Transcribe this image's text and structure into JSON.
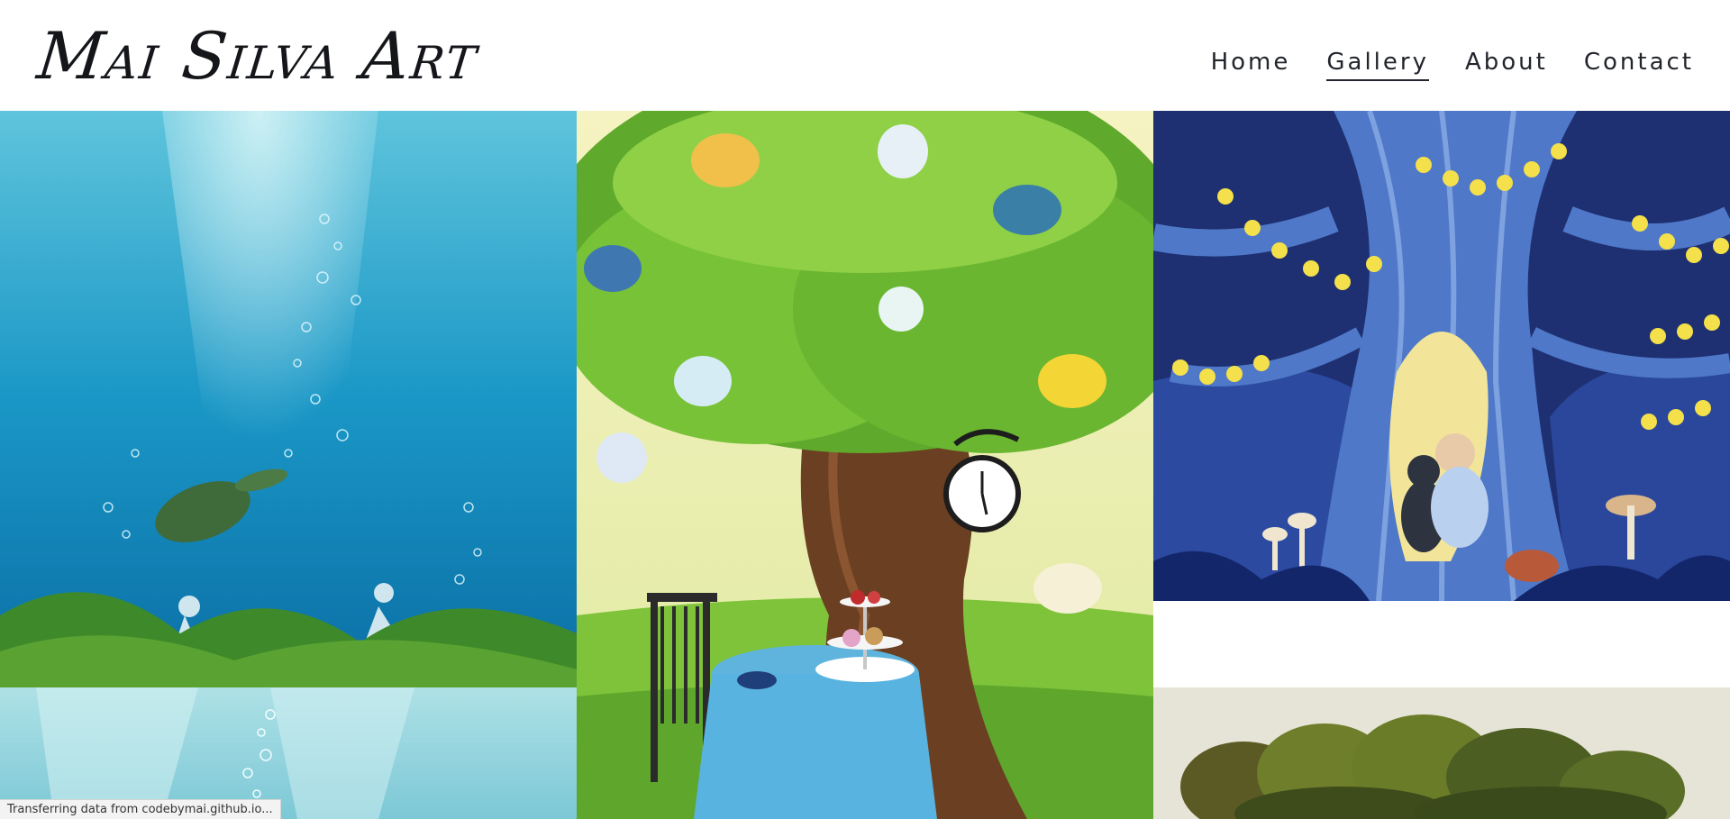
{
  "site": {
    "logo_text": "Mai Silva Art"
  },
  "nav": {
    "items": [
      {
        "label": "Home"
      },
      {
        "label": "Gallery"
      },
      {
        "label": "About"
      },
      {
        "label": "Contact"
      }
    ]
  },
  "gallery": {
    "artworks": [
      {
        "name": "ocean-turtles-girls-painting"
      },
      {
        "name": "teapot-tree-painting"
      },
      {
        "name": "night-tree-reading-girl-painting"
      },
      {
        "name": "ocean-light-rays-painting"
      },
      {
        "name": "green-treetops-painting"
      }
    ]
  },
  "status_bar": {
    "text": "Transferring data from codebymai.github.io..."
  },
  "colors": {
    "nav_text": "#22252b",
    "logo_text": "#14161a",
    "background": "#ffffff"
  }
}
